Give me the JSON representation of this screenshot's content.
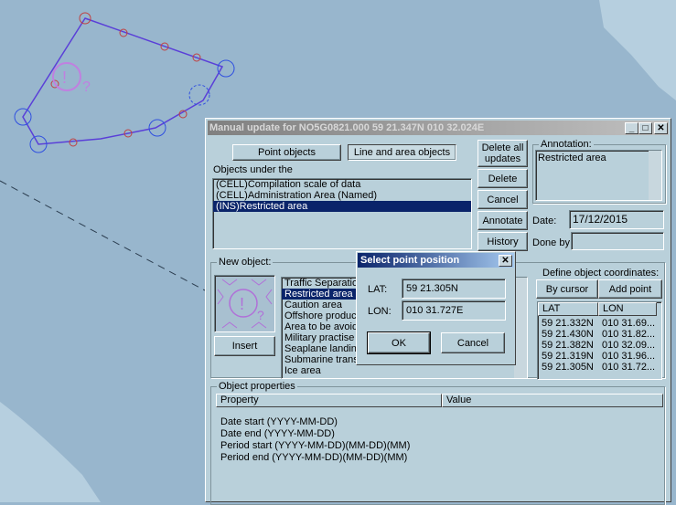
{
  "map": {
    "colors": {
      "water": "#98b6cd",
      "shore": "#b6cfdf",
      "route": "#5a3fd8"
    }
  },
  "main": {
    "title": "Manual update for NO5G0821.000  59 21.347N  010 32.024E",
    "tabs": [
      {
        "label": "Point objects"
      },
      {
        "label": "Line and area objects"
      }
    ],
    "objects_label": "Objects under the",
    "objects": [
      "(CELL)Compilation scale of data",
      "(CELL)Administration Area (Named)",
      "(INS)Restricted area"
    ],
    "buttons": {
      "delete_all": "Delete all updates",
      "delete": "Delete",
      "cancel": "Cancel",
      "annotate": "Annotate",
      "history": "History"
    },
    "annotation_label": "Annotation:",
    "annotation_value": "Restricted area",
    "date_label": "Date:",
    "date_value": "17/12/2015",
    "done_by_label": "Done by:",
    "done_by_value": "",
    "new_object_label": "New object:",
    "insert_label": "Insert",
    "object_types": [
      "Traffic Separation",
      "Restricted area",
      "Caution area",
      "Offshore productic",
      "Area to be avoide",
      "Military practise ar",
      "Seaplane landing",
      "Submarine transit",
      "Ice area"
    ],
    "define_coords_label": "Define object coordinates:",
    "by_cursor": "By cursor",
    "add_point": "Add point",
    "coord_headers": [
      "LAT",
      "LON"
    ],
    "coords": [
      [
        "59 21.332N",
        "010 31.69..."
      ],
      [
        "59 21.430N",
        "010 31.82..."
      ],
      [
        "59 21.382N",
        "010 32.09..."
      ],
      [
        "59 21.319N",
        "010 31.96..."
      ],
      [
        "59 21.305N",
        "010 31.72..."
      ]
    ],
    "properties_label": "Object properties",
    "prop_headers": [
      "Property",
      "Value"
    ],
    "properties": [
      "Date start (YYYY-MM-DD)",
      "Date end (YYYY-MM-DD)",
      "Period start (YYYY-MM-DD)(MM-DD)(MM)",
      "Period end (YYYY-MM-DD)(MM-DD)(MM)"
    ]
  },
  "popup": {
    "title": "Select point position",
    "lat_label": "LAT:",
    "lat_value": "59 21.305N",
    "lon_label": "LON:",
    "lon_value": "010 31.727E",
    "ok": "OK",
    "cancel": "Cancel"
  }
}
